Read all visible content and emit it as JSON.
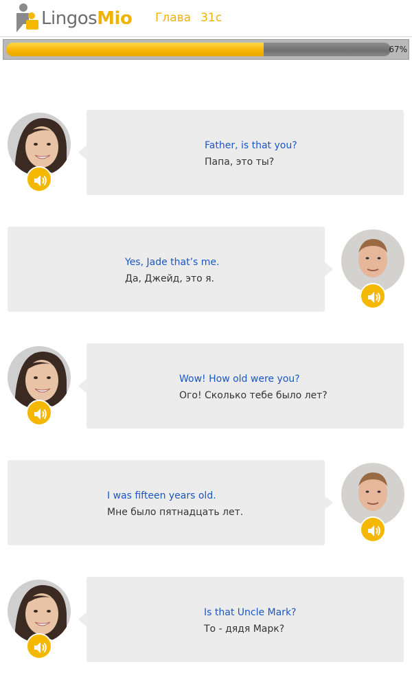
{
  "header": {
    "logo": {
      "part1": "Lingos",
      "part2": "Mio"
    },
    "chapter_label": "Глава",
    "chapter_number": "31c"
  },
  "progress": {
    "value": 0.67,
    "label": "67%"
  },
  "colors": {
    "accent": "#f5b800",
    "english_text": "#1a56c4",
    "bubble": "#ececec"
  },
  "dialogue": [
    {
      "speaker": "female",
      "side": "left",
      "english": "Father, is that you?",
      "russian": "Папа, это ты?"
    },
    {
      "speaker": "male",
      "side": "right",
      "english": "Yes, Jade that’s me.",
      "russian": "Да, Джейд, это я."
    },
    {
      "speaker": "female",
      "side": "left",
      "english": "Wow! How old were you?",
      "russian": "Ого! Сколько тебе было лет?"
    },
    {
      "speaker": "male",
      "side": "right",
      "english": "I was fifteen years old.",
      "russian": "Мне было пятнадцать лет."
    },
    {
      "speaker": "female",
      "side": "left",
      "english": "Is that Uncle Mark?",
      "russian": "То - дядя Марк?"
    }
  ]
}
